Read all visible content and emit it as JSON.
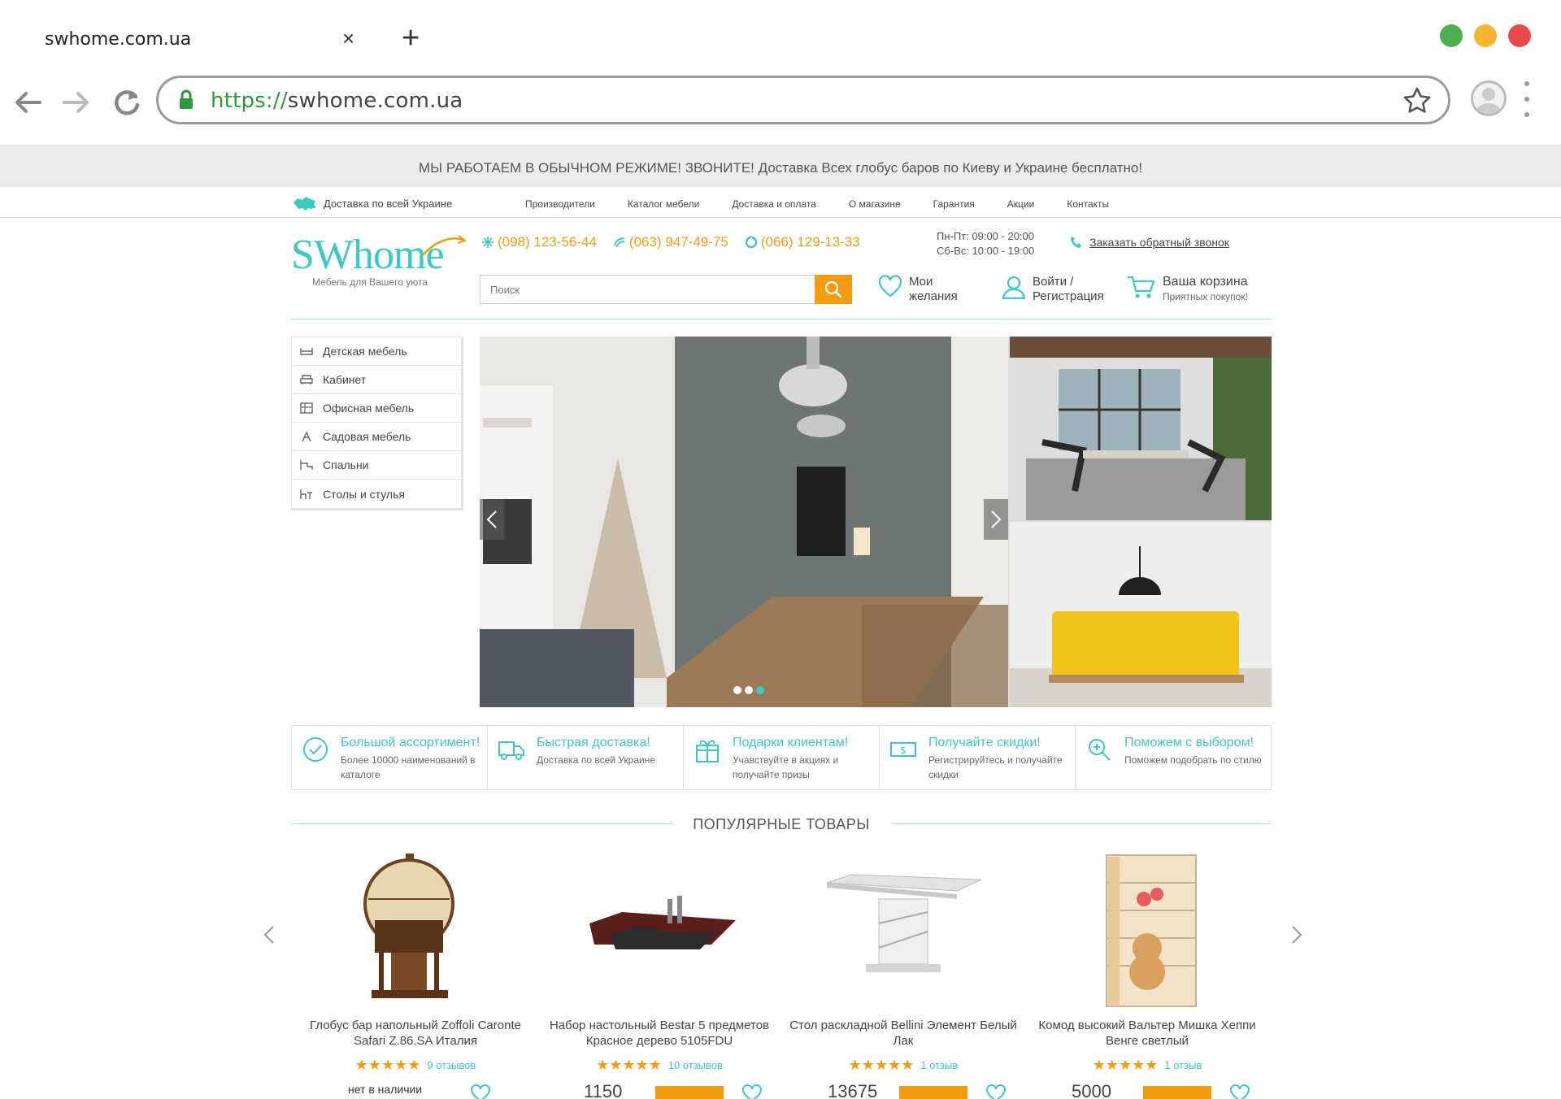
{
  "browser": {
    "tab_title": "swhome.com.ua",
    "tab_close": "×",
    "tab_new": "+",
    "url_scheme": "https://",
    "url_host": "swhome.com.ua",
    "window_colors": [
      "#4caf50",
      "#f5b731",
      "#e94b4b"
    ]
  },
  "promo_text": "МЫ РАБОТАЕМ В ОБЫЧНОМ РЕЖИМЕ! ЗВОНИТЕ! Доставка Всех глобус баров по Киеву и Украине бесплатно!",
  "topnav": {
    "delivery": "Доставка по всей Украине",
    "links": [
      "Производители",
      "Каталог мебели",
      "Доставка и оплата",
      "О магазине",
      "Гарантия",
      "Акции",
      "Контакты"
    ]
  },
  "header": {
    "logo": "SWhome",
    "logo_sub": "Мебель для Вашего уюта",
    "phones": [
      "(098) 123-56-44",
      "(063) 947-49-75",
      "(066) 129-13-33"
    ],
    "hours_weekday": "Пн-Пт: 09:00 - 20:00",
    "hours_weekend": "Сб-Вс: 10:00 - 19:00",
    "callback": "Заказать обратный звонок",
    "search_placeholder": "Поиск",
    "wishlist_line1": "Мои",
    "wishlist_line2": "желания",
    "login_line1": "Войти /",
    "login_line2": "Регистрация",
    "cart_title": "Ваша корзина",
    "cart_sub": "Приятных покупок!"
  },
  "categories": [
    "Детская мебель",
    "Кабинет",
    "Офисная мебель",
    "Садовая мебель",
    "Спальни",
    "Столы и стулья"
  ],
  "features": [
    {
      "title": "Большой ассортимент!",
      "desc": "Более 10000 наименований в каталоге"
    },
    {
      "title": "Быстрая доставка!",
      "desc": "Доставка по всей Украине"
    },
    {
      "title": "Подарки клиентам!",
      "desc": "Учавствуйте в акциях и получайте призы"
    },
    {
      "title": "Получайте скидки!",
      "desc": "Регистрируйтесь и получайте скидки"
    },
    {
      "title": "Поможем с выбором!",
      "desc": "Поможем подобрать по стилю"
    }
  ],
  "popular_title": "ПОПУЛЯРНЫЕ ТОВАРЫ",
  "products": [
    {
      "name": "Глобус бар напольный Zoffoli Caronte Safari Z.86.SA Италия",
      "stars": "★★★★★",
      "reviews": "9 отзывов",
      "bottom": "нет в наличии"
    },
    {
      "name": "Набор настольный Bestar 5 предметов Красное дерево 5105FDU",
      "stars": "★★★★★",
      "reviews": "10 отзывов",
      "bottom": "1150"
    },
    {
      "name": "Стол раскладной Bellini Элемент Белый Лак",
      "stars": "★★★★★",
      "reviews": "1 отзыв",
      "bottom": "13675"
    },
    {
      "name": "Комод высокий Вальтер Мишка Хеппи Венге светлый",
      "stars": "★★★★★",
      "reviews": "1 отзыв",
      "bottom": "5000"
    }
  ],
  "colors": {
    "accent": "#3cc9c3",
    "orange": "#f39c12"
  }
}
